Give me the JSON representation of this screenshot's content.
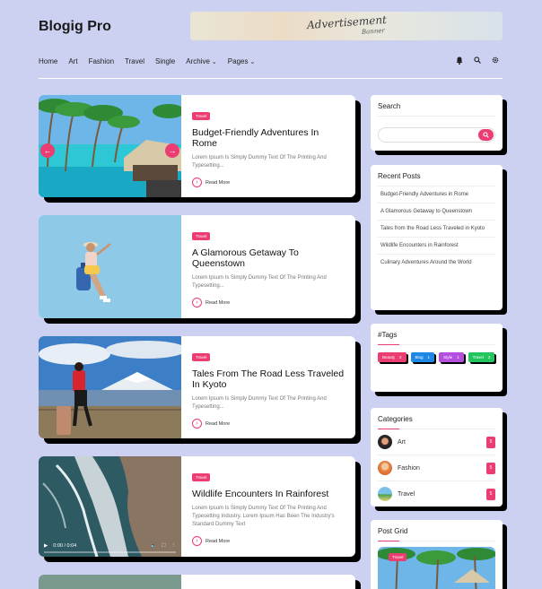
{
  "site": {
    "logo": "Blogig Pro",
    "ad_line1": "Advertisement",
    "ad_line2": "Banner"
  },
  "nav": {
    "items": [
      "Home",
      "Art",
      "Fashion",
      "Travel",
      "Single"
    ],
    "dropdowns": [
      "Archive",
      "Pages"
    ],
    "icons": [
      "bell-icon",
      "search-icon",
      "settings-icon"
    ]
  },
  "posts": [
    {
      "badge": "Travel",
      "title": "Budget-Friendly Adventures In Rome",
      "excerpt": "Lorem Ipsum Is Simply Dummy Text Of The Printing And Typesetting...",
      "readmore": "Read More"
    },
    {
      "badge": "Travel",
      "title": "A Glamorous Getaway To Queenstown",
      "excerpt": "Lorem Ipsum Is Simply Dummy Text Of The Printing And Typesetting...",
      "readmore": "Read More"
    },
    {
      "badge": "Travel",
      "title": "Tales From The Road Less Traveled In Kyoto",
      "excerpt": "Lorem Ipsum Is Simply Dummy Text Of The Printing And Typesetting...",
      "readmore": "Read More"
    },
    {
      "badge": "Travel",
      "title": "Wildlife Encounters In Rainforest",
      "excerpt": "Lorem Ipsum Is Simply Dummy Text Of The Printing And Typesetting Industry. Lorem Ipsum Has Been The Industry's Standard Dummy Text",
      "readmore": "Read More"
    }
  ],
  "video": {
    "time": "0:00 / 0:04"
  },
  "sidebar": {
    "search_title": "Search",
    "recent_title": "Recent Posts",
    "recent": [
      "Budget-Friendly Adventures in Rome",
      "A Glamorous Getaway to Queenstown",
      "Tales from the Road Less Traveled in Kyoto",
      "Wildlife Encounters in Rainforest",
      "Culinary Adventures Around the World"
    ],
    "tags_title": "#Tags",
    "tags": [
      {
        "label": "Beauty",
        "count": "2",
        "color": "#ec3d72"
      },
      {
        "label": "Blog",
        "count": "1",
        "color": "#1e88e5"
      },
      {
        "label": "Style",
        "count": "1",
        "color": "#b44fe0"
      },
      {
        "label": "Travel",
        "count": "2",
        "color": "#22c55e"
      }
    ],
    "categories_title": "Categories",
    "categories": [
      {
        "label": "Art",
        "count": "5"
      },
      {
        "label": "Fashion",
        "count": "5"
      },
      {
        "label": "Travel",
        "count": "5"
      }
    ],
    "postgrid_title": "Post Grid",
    "postgrid_badge": "Travel"
  },
  "colors": {
    "accent": "#ec3d72",
    "background": "#cdd1f1"
  }
}
